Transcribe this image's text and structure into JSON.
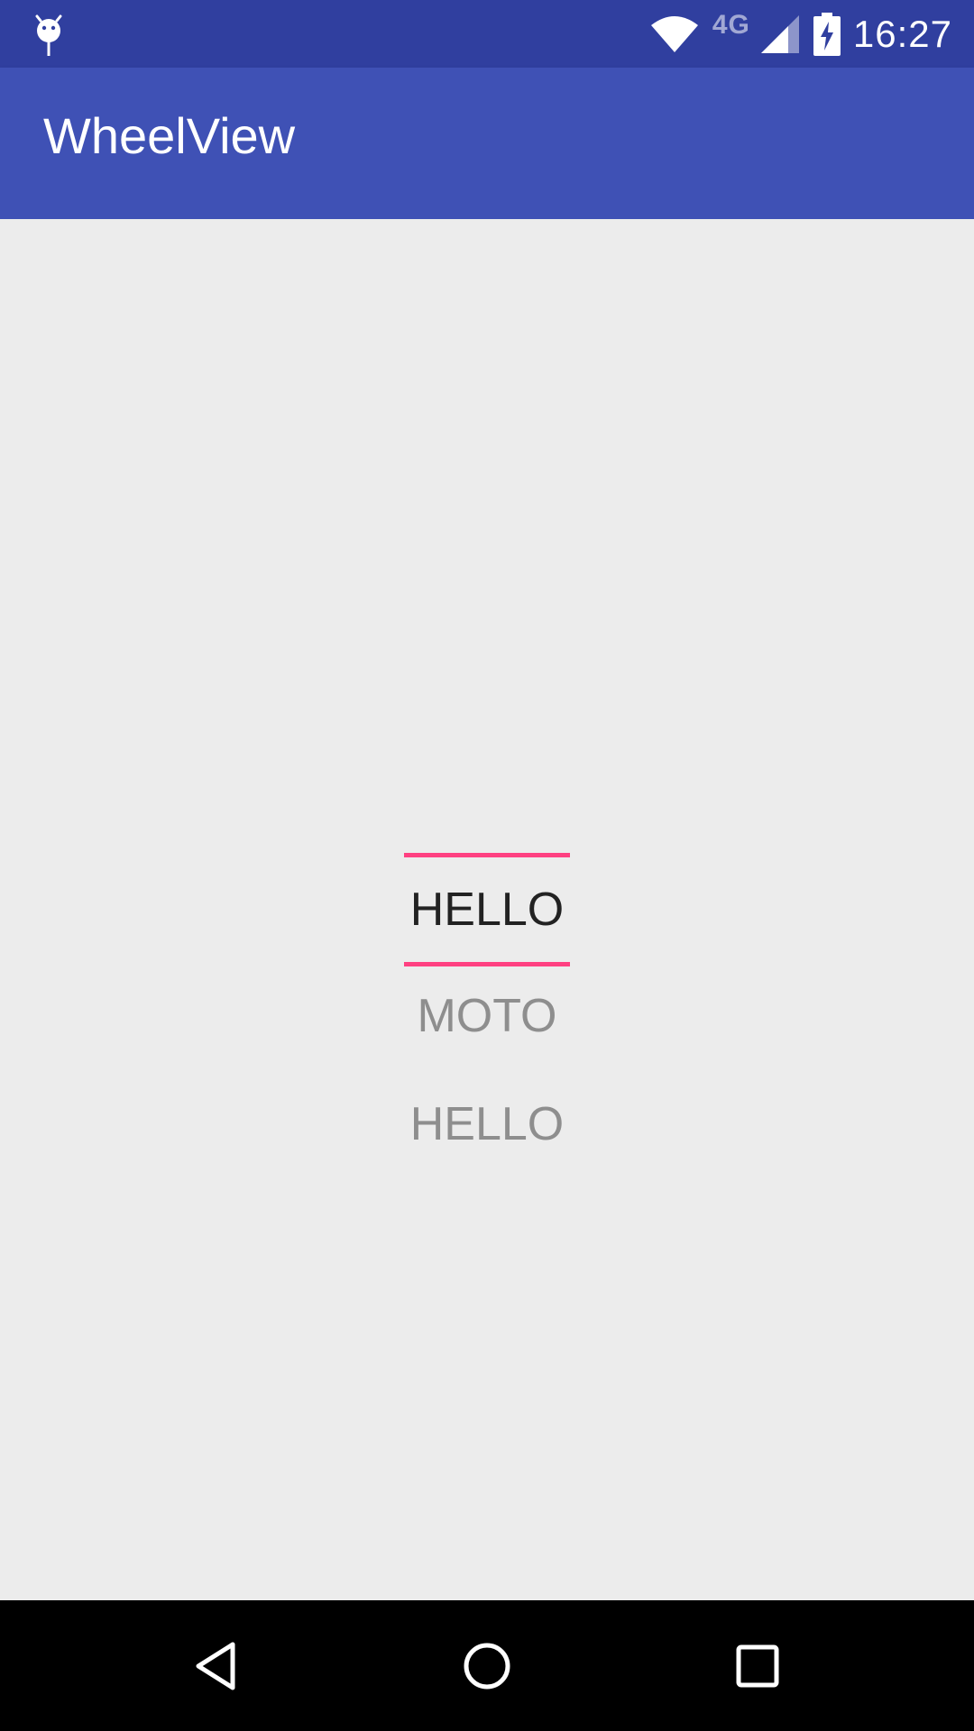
{
  "status_bar": {
    "network_type": "4G",
    "time": "16:27",
    "icons": [
      "android-debug-icon",
      "wifi-icon",
      "signal-icon",
      "battery-charging-icon"
    ],
    "background_color": "#303f9f"
  },
  "app_bar": {
    "title": "WheelView",
    "background_color": "#3f51b5"
  },
  "wheel": {
    "divider_color": "#ff4081",
    "items": [
      {
        "label": "HELLO",
        "selected": true
      },
      {
        "label": "MOTO",
        "selected": false
      },
      {
        "label": "HELLO",
        "selected": false
      }
    ]
  },
  "nav_bar": {
    "buttons": [
      "back-icon",
      "home-icon",
      "recents-icon"
    ]
  }
}
